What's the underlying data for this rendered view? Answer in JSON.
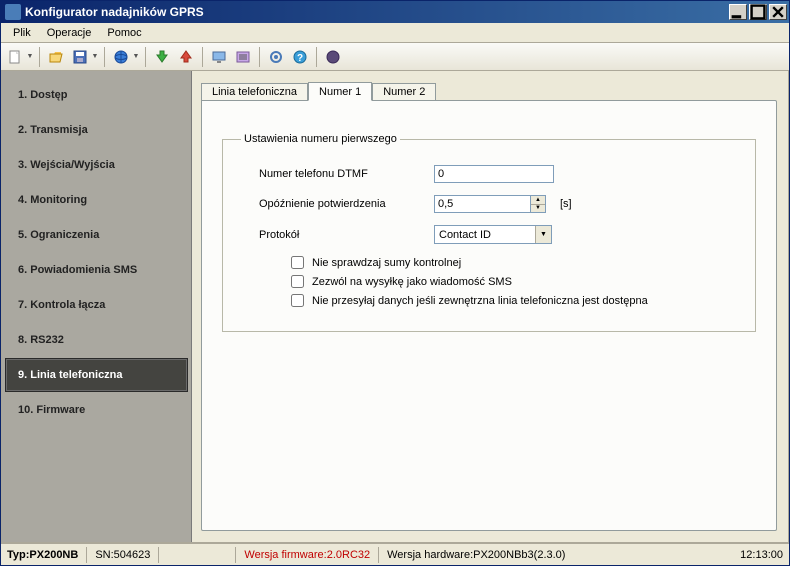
{
  "window": {
    "title": "Konfigurator nadajników GPRS"
  },
  "menu": {
    "plik": "Plik",
    "operacje": "Operacje",
    "pomoc": "Pomoc"
  },
  "sidebar": {
    "items": [
      {
        "label": "1. Dostęp"
      },
      {
        "label": "2. Transmisja"
      },
      {
        "label": "3. Wejścia/Wyjścia"
      },
      {
        "label": "4. Monitoring"
      },
      {
        "label": "5. Ograniczenia"
      },
      {
        "label": "6. Powiadomienia SMS"
      },
      {
        "label": "7. Kontrola łącza"
      },
      {
        "label": "8. RS232"
      },
      {
        "label": "9. Linia telefoniczna"
      },
      {
        "label": "10. Firmware"
      }
    ],
    "active_index": 8
  },
  "tabs": {
    "items": [
      {
        "label": "Linia telefoniczna"
      },
      {
        "label": "Numer 1"
      },
      {
        "label": "Numer 2"
      }
    ],
    "active_index": 1
  },
  "form": {
    "legend": "Ustawienia numeru pierwszego",
    "phone": {
      "label": "Numer telefonu DTMF",
      "value": "0"
    },
    "delay": {
      "label": "Opóźnienie potwierdzenia",
      "value": "0,5",
      "unit": "[s]"
    },
    "protocol": {
      "label": "Protokół",
      "selected": "Contact ID",
      "options": [
        "Contact ID"
      ]
    },
    "checks": {
      "no_checksum": {
        "label": "Nie sprawdzaj sumy kontrolnej",
        "checked": false
      },
      "allow_sms": {
        "label": "Zezwól na wysyłkę jako wiadomość SMS",
        "checked": false
      },
      "no_ext_line": {
        "label": "Nie przesyłaj danych jeśli zewnętrzna linia telefoniczna jest dostępna",
        "checked": false
      }
    }
  },
  "status": {
    "typ_label": "Typ: ",
    "typ_value": "PX200NB",
    "sn_label": "SN: ",
    "sn_value": "504623",
    "fw_label": "Wersja firmware: ",
    "fw_value": "2.0RC32",
    "hw_label": "Wersja hardware: ",
    "hw_value": "PX200NBb3(2.3.0)",
    "time": "12:13:00"
  },
  "colors": {
    "titlebar_start": "#0a246a",
    "titlebar_end": "#3a6ea5",
    "sidebar_bg": "#aaa8a0",
    "sidebar_active_bg": "#444440",
    "panel_bg": "#ece9d8",
    "tab_body_bg": "#fcfcfa",
    "input_border": "#7f9db9",
    "firmware_text": "#c00000"
  }
}
